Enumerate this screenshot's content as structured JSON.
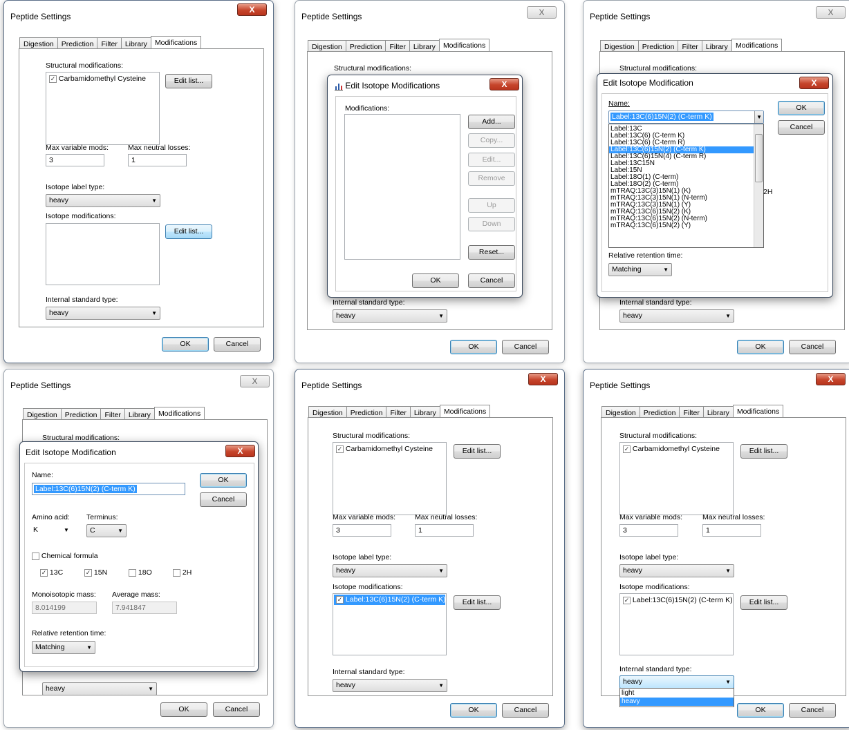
{
  "common": {
    "window_title": "Peptide Settings",
    "close_glyph": "X",
    "tabs": [
      "Digestion",
      "Prediction",
      "Filter",
      "Library",
      "Modifications"
    ],
    "structural_label": "Structural modifications:",
    "carbamidomethyl": "Carbamidomethyl Cysteine",
    "edit_list": "Edit list...",
    "max_variable_mods": "Max variable mods:",
    "max_neutral_losses": "Max neutral losses:",
    "max_variable_value": "3",
    "max_neutral_value": "1",
    "isotope_label_type": "Isotope label type:",
    "heavy": "heavy",
    "light": "light",
    "isotope_modifications": "Isotope modifications:",
    "internal_standard_type": "Internal standard type:",
    "ok": "OK",
    "cancel": "Cancel",
    "checkmark": "✓",
    "dropdown_arrow": "▼"
  },
  "panel2": {
    "dialog_title": "Edit Isotope Modifications",
    "modifications_label": "Modifications:",
    "buttons": {
      "add": "Add...",
      "copy": "Copy...",
      "edit": "Edit...",
      "remove": "Remove",
      "up": "Up",
      "down": "Down",
      "reset": "Reset..."
    },
    "ghost_letters": [
      "N",
      "3",
      "Is",
      "h",
      "Is"
    ]
  },
  "panel3": {
    "dialog_title": "Edit Isotope Modification",
    "name_label": "Name:",
    "name_value": "Label:13C(6)15N(2) (C-term K)",
    "list_items": [
      "Label:13C",
      "Label:13C(6) (C-term K)",
      "Label:13C(6) (C-term R)",
      "Label:13C(6)15N(2) (C-term K)",
      "Label:13C(6)15N(4) (C-term R)",
      "Label:13C15N",
      "Label:15N",
      "Label:18O(1) (C-term)",
      "Label:18O(2) (C-term)",
      "mTRAQ:13C(3)15N(1) (K)",
      "mTRAQ:13C(3)15N(1) (N-term)",
      "mTRAQ:13C(3)15N(1) (Y)",
      "mTRAQ:13C(6)15N(2) (K)",
      "mTRAQ:13C(6)15N(2) (N-term)",
      "mTRAQ:13C(6)15N(2) (Y)"
    ],
    "selected_index": 3,
    "partial_text": "2H",
    "relative_retention_time": "Relative retention time:",
    "matching": "Matching"
  },
  "panel4": {
    "dialog_title": "Edit Isotope Modification",
    "name_label": "Name:",
    "name_value": "Label:13C(6)15N(2) (C-term K)",
    "amino_acid_label": "Amino acid:",
    "amino_acid_value": "K",
    "terminus_label": "Terminus:",
    "terminus_value": "C",
    "chemical_formula": "Chemical formula",
    "isotopes": [
      {
        "label": "13C",
        "checked": true
      },
      {
        "label": "15N",
        "checked": true
      },
      {
        "label": "18O",
        "checked": false
      },
      {
        "label": "2H",
        "checked": false
      }
    ],
    "mono_label": "Monoisotopic mass:",
    "avg_label": "Average mass:",
    "mono_value": "8.014199",
    "avg_value": "7.941847",
    "relative_retention_time": "Relative retention time:",
    "matching": "Matching"
  },
  "panel5": {
    "isotope_mod_item": "Label:13C(6)15N(2) (C-term K)"
  },
  "panel6": {
    "isotope_mod_item": "Label:13C(6)15N(2) (C-term K)",
    "dropdown_options": [
      "light",
      "heavy"
    ],
    "selected": "heavy"
  }
}
